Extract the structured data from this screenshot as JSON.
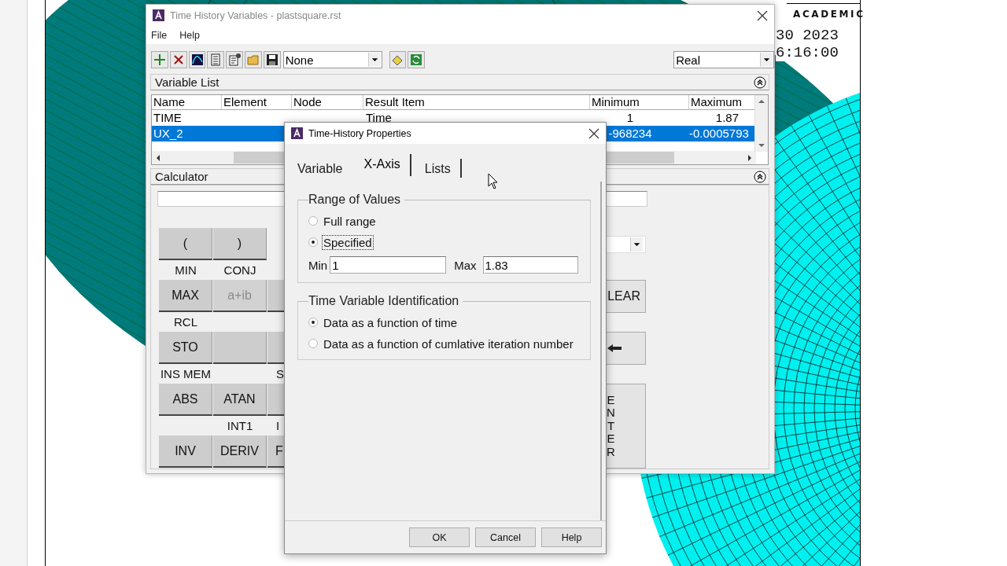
{
  "graphics": {
    "watermark": "ACADEMIC",
    "date": "30 2023",
    "time": "6:16:00"
  },
  "main_window": {
    "title": "Time History Variables - plastsquare.rst",
    "menu": [
      "File",
      "Help"
    ],
    "toolbar": {
      "variable_combo": "None",
      "format_combo": "Real"
    },
    "variable_list": {
      "title": "Variable List",
      "expanded": true,
      "columns": [
        "Name",
        "Element",
        "Node",
        "Result Item",
        "Minimum",
        "Maximum"
      ],
      "rows": [
        {
          "name": "TIME",
          "result_item": "Time",
          "minimum": "1",
          "maximum": "1.87",
          "selected": false
        },
        {
          "name": "UX_2",
          "minimum": "-968234",
          "maximum": "-0.0005793",
          "selected": true
        }
      ]
    },
    "calculator": {
      "title": "Calculator",
      "expanded": true,
      "rows": [
        [
          {
            "text": "(",
            "disabled": false
          },
          {
            "text": ")",
            "disabled": false
          }
        ],
        [
          {
            "shift": "MIN",
            "text": "MAX",
            "disabled": false
          },
          {
            "shift": "CONJ",
            "text": "a+ib",
            "disabled": true
          },
          {
            "disabled": false
          }
        ],
        [
          {
            "shift": "RCL",
            "text": "STO",
            "disabled": false
          },
          {
            "disabled": false
          },
          {
            "disabled": false
          }
        ],
        [
          {
            "shift": "INS MEM",
            "text": "ABS",
            "disabled": false
          },
          {
            "text": "ATAN",
            "disabled": false
          },
          {
            "shift": "S",
            "disabled": false
          }
        ],
        [
          {
            "text": "INV",
            "disabled": false
          },
          {
            "shift": "INT1",
            "text": "DERIV",
            "disabled": false
          },
          {
            "shift": "I",
            "text": "F",
            "disabled": false
          }
        ]
      ],
      "side_buttons": [
        {
          "kind": "text",
          "text": "LEAR"
        },
        {
          "kind": "arrow"
        },
        {
          "kind": "vertical",
          "text": "ENTER"
        }
      ]
    }
  },
  "dialog": {
    "title": "Time-History Properties",
    "tabs": [
      {
        "label": "Variable",
        "selected": false
      },
      {
        "label": "X-Axis",
        "selected": true
      },
      {
        "label": "Lists",
        "selected": false
      }
    ],
    "range_group": {
      "title": "Range of Values",
      "options": [
        {
          "label": "Full range",
          "selected": false,
          "focused": false
        },
        {
          "label": "Specified",
          "selected": true,
          "focused": true
        }
      ],
      "min_label": "Min",
      "min_value": "1",
      "max_label": "Max",
      "max_value": "1.83"
    },
    "time_group": {
      "title": "Time Variable Identification",
      "options": [
        {
          "label": "Data as a function of time",
          "selected": true
        },
        {
          "label": "Data as a function of cumlative iteration number",
          "selected": false
        }
      ]
    },
    "buttons": [
      "OK",
      "Cancel",
      "Help"
    ]
  }
}
